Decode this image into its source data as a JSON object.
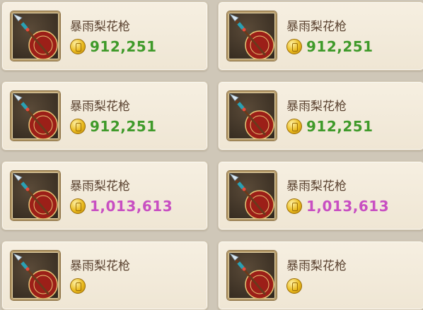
{
  "items": [
    {
      "name": "暴雨梨花枪",
      "icon": "spear-item-icon",
      "currency_icon": "gold-coin-icon",
      "price": "912,251",
      "price_color": "#3f9a2a"
    },
    {
      "name": "暴雨梨花枪",
      "icon": "spear-item-icon",
      "currency_icon": "gold-coin-icon",
      "price": "912,251",
      "price_color": "#3f9a2a"
    },
    {
      "name": "暴雨梨花枪",
      "icon": "spear-item-icon",
      "currency_icon": "gold-coin-icon",
      "price": "912,251",
      "price_color": "#3f9a2a"
    },
    {
      "name": "暴雨梨花枪",
      "icon": "spear-item-icon",
      "currency_icon": "gold-coin-icon",
      "price": "912,251",
      "price_color": "#3f9a2a"
    },
    {
      "name": "暴雨梨花枪",
      "icon": "spear-item-icon",
      "currency_icon": "gold-coin-icon",
      "price": "1,013,613",
      "price_color": "#c84fc2"
    },
    {
      "name": "暴雨梨花枪",
      "icon": "spear-item-icon",
      "currency_icon": "gold-coin-icon",
      "price": "1,013,613",
      "price_color": "#c84fc2"
    },
    {
      "name": "暴雨梨花枪",
      "icon": "spear-item-icon",
      "currency_icon": "gold-coin-icon",
      "price": "",
      "price_color": "#c84fc2"
    },
    {
      "name": "暴雨梨花枪",
      "icon": "spear-item-icon",
      "currency_icon": "gold-coin-icon",
      "price": "",
      "price_color": "#c84fc2"
    }
  ]
}
